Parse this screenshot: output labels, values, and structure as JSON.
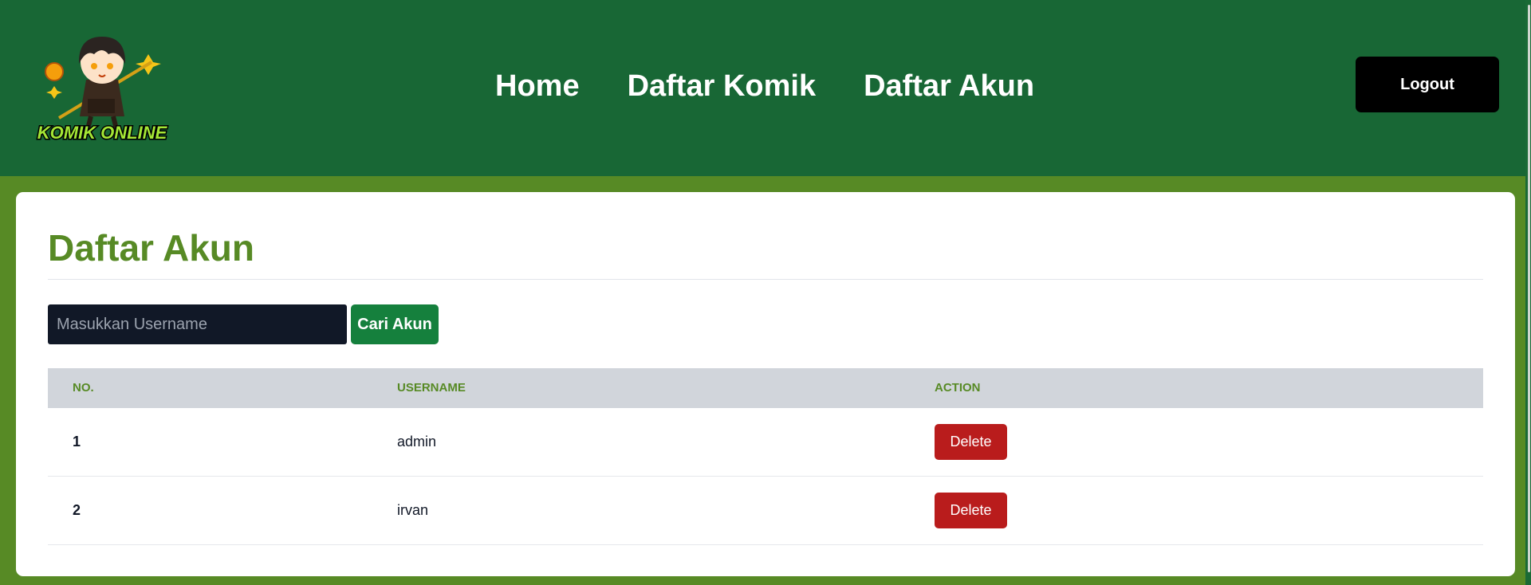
{
  "brand": {
    "logo_text": "KOMIK ONLINE"
  },
  "nav": {
    "items": [
      "Home",
      "Daftar Komik",
      "Daftar Akun"
    ]
  },
  "header": {
    "logout_label": "Logout"
  },
  "page": {
    "title": "Daftar Akun"
  },
  "search": {
    "placeholder": "Masukkan Username",
    "value": "",
    "button_label": "Cari Akun"
  },
  "table": {
    "columns": [
      "NO.",
      "USERNAME",
      "ACTION"
    ],
    "rows": [
      {
        "no": "1",
        "username": "admin",
        "action_label": "Delete"
      },
      {
        "no": "2",
        "username": "irvan",
        "action_label": "Delete"
      }
    ]
  },
  "colors": {
    "header_bg": "#186735",
    "page_bg": "#578a25",
    "accent_text": "#578a25",
    "search_button": "#15803d",
    "delete_button": "#b91c1c",
    "logout_button": "#000000"
  }
}
